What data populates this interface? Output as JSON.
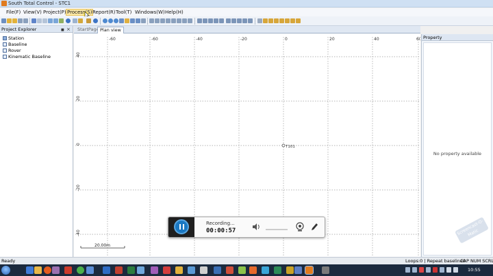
{
  "window": {
    "title": "South Total Control - STC1"
  },
  "menu": [
    {
      "label": "File(F)",
      "active": false
    },
    {
      "label": "View(V)",
      "active": false
    },
    {
      "label": "Project(P)",
      "active": false
    },
    {
      "label": "Process(S)",
      "active": true
    },
    {
      "label": "Report(R)",
      "active": false
    },
    {
      "label": "Tool(T)",
      "active": false
    },
    {
      "label": "Windows(W)",
      "active": false
    },
    {
      "label": "Help(H)",
      "active": false
    }
  ],
  "explorer": {
    "title": "Project Explorer",
    "pin_glyph": "■",
    "close_glyph": "×",
    "items": [
      "Station",
      "Baseline",
      "Rover",
      "Kinematic Baseline"
    ]
  },
  "tabs": [
    {
      "label": "StartPage",
      "active": false
    },
    {
      "label": "Plan view",
      "active": true
    }
  ],
  "plan": {
    "x_ticks": [
      "-60",
      "-60",
      "-40",
      "-20",
      "0",
      "20",
      "40",
      "60"
    ],
    "y_ticks": [
      "40",
      "20",
      "0",
      "-20",
      "-40"
    ],
    "point_label": "T101",
    "scale_label": "20.00m"
  },
  "property": {
    "title": "Property",
    "empty_text": "No property available"
  },
  "watermark": {
    "text": "Screencast-O-Matic"
  },
  "recorder": {
    "status": "Recording...",
    "time": "00:00:57"
  },
  "statusbar": {
    "left": "Ready",
    "right": "Loops:0 | Repeat baseline0",
    "caps": "CAP  NUM  SCRL"
  },
  "taskbar": {
    "clock": "10:55"
  },
  "colors": {
    "grid": "#9a9a9a",
    "pause_button": "#1a78c2",
    "taskbar": "#1b2a3e",
    "active_menu": "#fbe8a6"
  }
}
